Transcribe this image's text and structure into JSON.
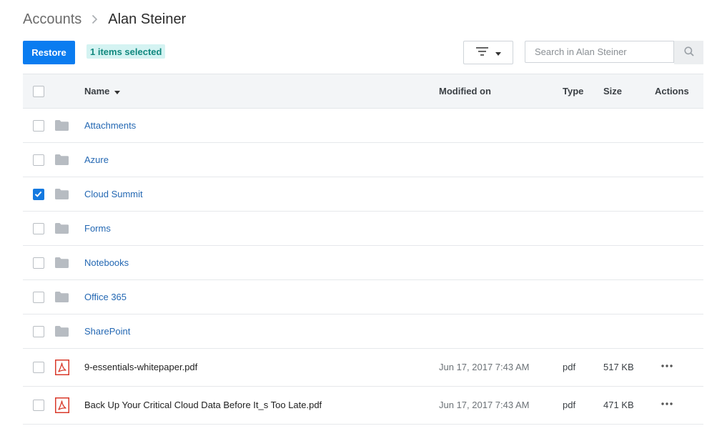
{
  "breadcrumb": {
    "root": "Accounts",
    "current": "Alan Steiner"
  },
  "toolbar": {
    "restore_label": "Restore",
    "selected_badge": "1 items selected",
    "search_placeholder": "Search in Alan Steiner"
  },
  "table": {
    "headers": {
      "name": "Name",
      "modified": "Modified on",
      "type": "Type",
      "size": "Size",
      "actions": "Actions"
    },
    "folders": [
      {
        "name": "Attachments",
        "checked": false
      },
      {
        "name": "Azure",
        "checked": false
      },
      {
        "name": "Cloud Summit",
        "checked": true
      },
      {
        "name": "Forms",
        "checked": false
      },
      {
        "name": "Notebooks",
        "checked": false
      },
      {
        "name": "Office 365",
        "checked": false
      },
      {
        "name": "SharePoint",
        "checked": false
      }
    ],
    "files": [
      {
        "name": "9-essentials-whitepaper.pdf",
        "modified": "Jun 17, 2017 7:43 AM",
        "type": "pdf",
        "size": "517 KB",
        "checked": false
      },
      {
        "name": "Back Up Your Critical Cloud Data Before It_s Too Late.pdf",
        "modified": "Jun 17, 2017 7:43 AM",
        "type": "pdf",
        "size": "471 KB",
        "checked": false
      }
    ]
  },
  "colors": {
    "accent": "#0a7cf0",
    "link": "#2468b3",
    "badge_bg": "#d4f3f2",
    "badge_text": "#12897f",
    "pdf_icon": "#d93a2b",
    "folder_icon": "#b7bcc2"
  },
  "icons": {
    "breadcrumb_separator": "chevron-right-icon",
    "sort": "caret-down-icon",
    "filter": "filter-icon",
    "search": "search-icon",
    "folder": "folder-icon",
    "file": "pdf-file-icon",
    "more": "more-horizontal-icon"
  }
}
